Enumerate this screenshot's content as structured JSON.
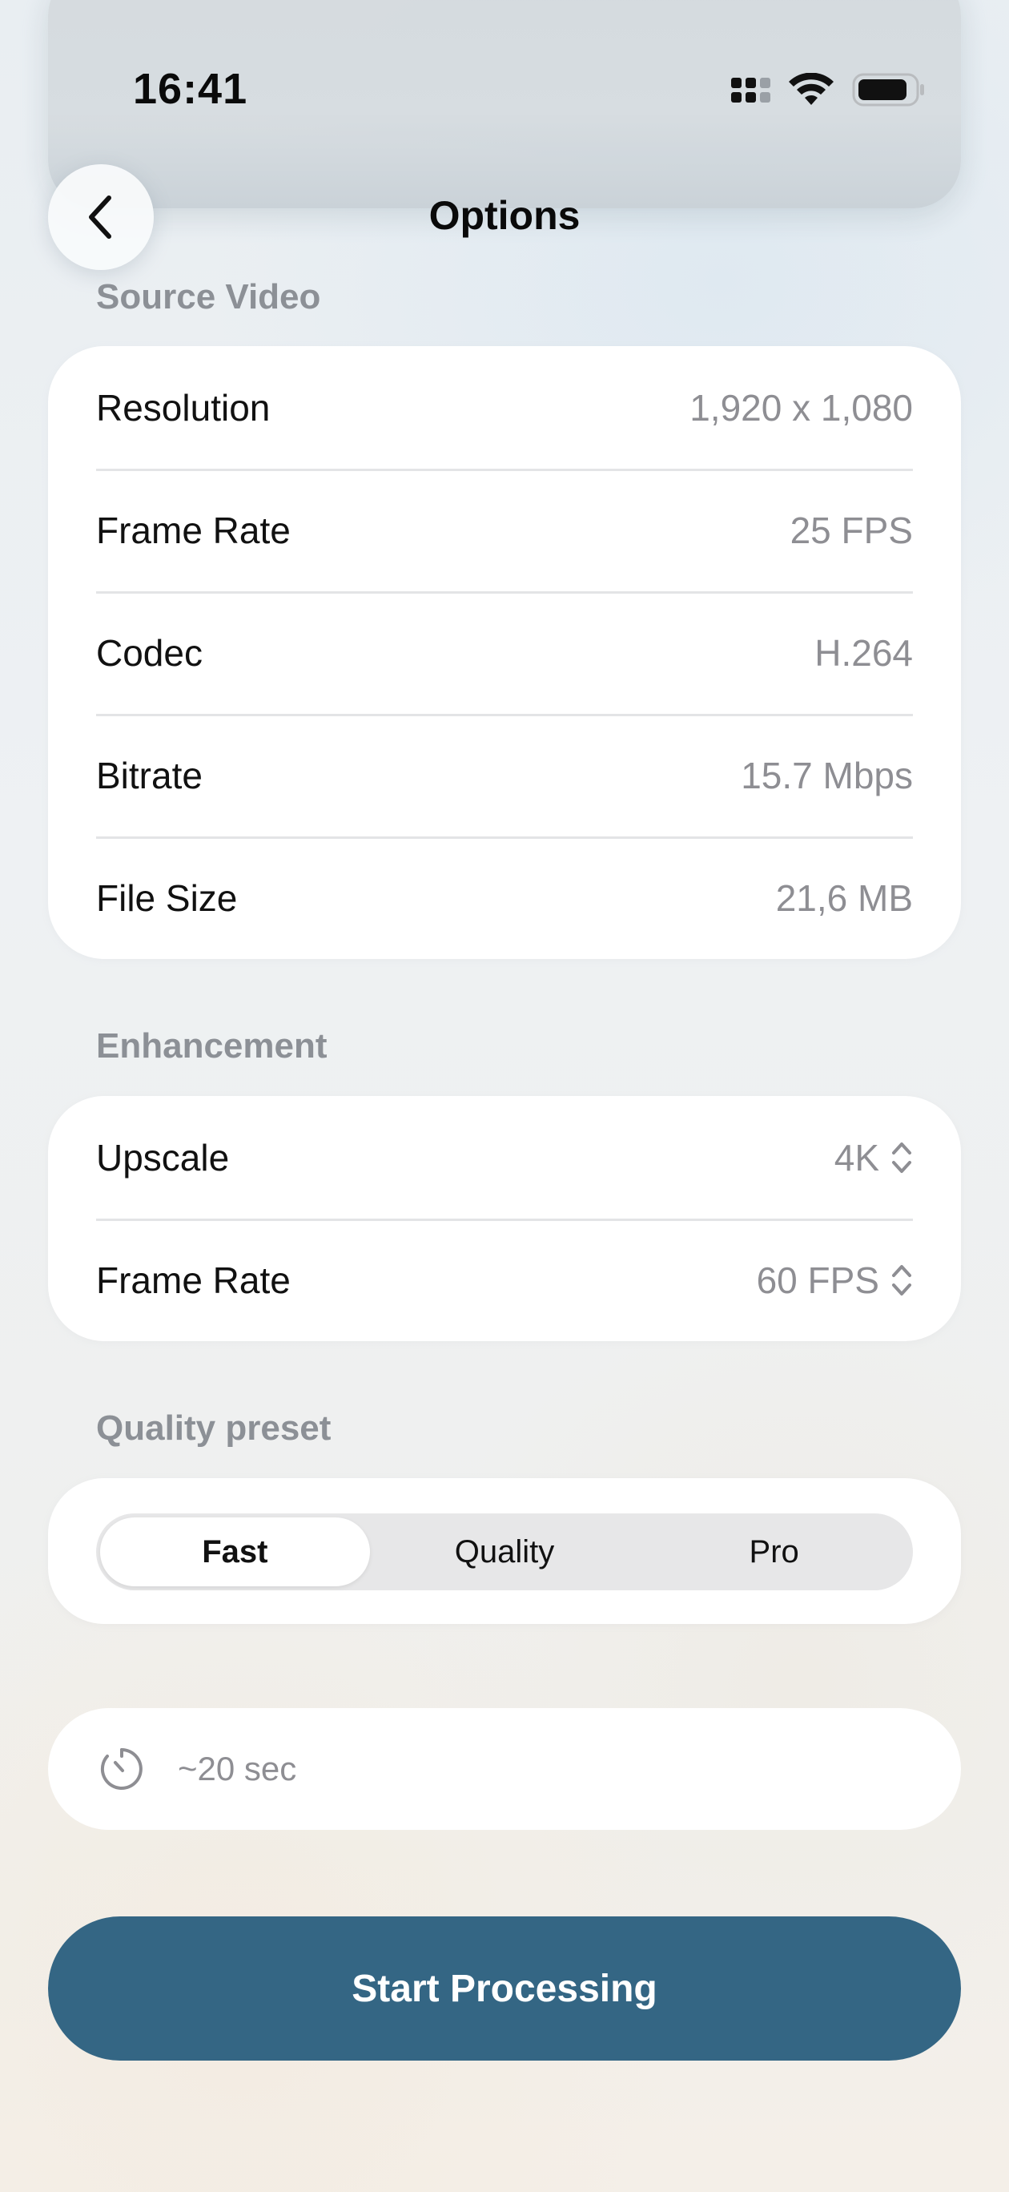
{
  "status_bar": {
    "time": "16:41"
  },
  "header": {
    "title": "Options"
  },
  "source_video": {
    "section_label": "Source Video",
    "rows": [
      {
        "label": "Resolution",
        "value": "1,920 x 1,080"
      },
      {
        "label": "Frame Rate",
        "value": "25 FPS"
      },
      {
        "label": "Codec",
        "value": "H.264"
      },
      {
        "label": "Bitrate",
        "value": "15.7 Mbps"
      },
      {
        "label": "File Size",
        "value": "21,6 MB"
      }
    ]
  },
  "enhancement": {
    "section_label": "Enhancement",
    "rows": [
      {
        "label": "Upscale",
        "value": "4K"
      },
      {
        "label": "Frame Rate",
        "value": "60 FPS"
      }
    ]
  },
  "quality_preset": {
    "section_label": "Quality preset",
    "options": [
      "Fast",
      "Quality",
      "Pro"
    ],
    "selected": "Fast"
  },
  "estimate": {
    "text": "~20 sec",
    "icon": "timer-icon"
  },
  "actions": {
    "primary_label": "Start Processing"
  },
  "colors": {
    "accent": "#346684",
    "secondary_text": "#8e8e93",
    "section_label": "#8c9096"
  }
}
